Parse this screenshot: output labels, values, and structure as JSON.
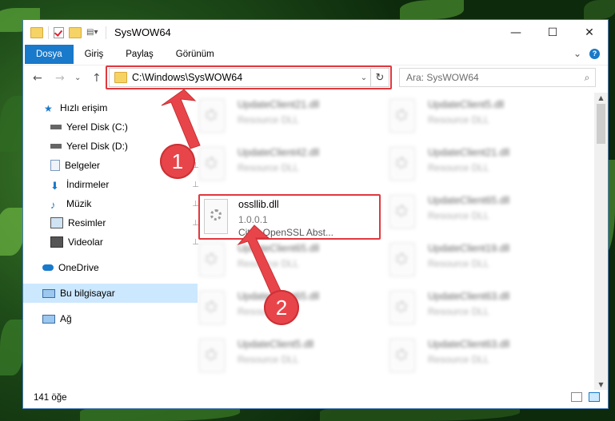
{
  "window": {
    "title": "SysWOW64",
    "buttons": {
      "minimize": "—",
      "maximize": "☐",
      "close": "✕"
    }
  },
  "ribbon": {
    "tabs": [
      "Dosya",
      "Giriş",
      "Paylaş",
      "Görünüm"
    ],
    "expand": "⌄",
    "help": "?"
  },
  "nav": {
    "back": "←",
    "forward": "→",
    "recent": "⌄",
    "up": "↑",
    "address": "C:\\Windows\\SysWOW64",
    "address_chevron": "⌄",
    "refresh": "↻",
    "search_placeholder": "Ara: SysWOW64",
    "search_icon": "⌕"
  },
  "sidebar": {
    "items": [
      {
        "label": "Hızlı erişim",
        "icon": "star-icon",
        "pinned": false
      },
      {
        "label": "Yerel Disk (C:)",
        "icon": "drive-icon",
        "pinned": true
      },
      {
        "label": "Yerel Disk (D:)",
        "icon": "drive-icon",
        "pinned": true
      },
      {
        "label": "Belgeler",
        "icon": "documents-icon",
        "pinned": true
      },
      {
        "label": "İndirmeler",
        "icon": "downloads-icon",
        "pinned": true
      },
      {
        "label": "Müzik",
        "icon": "music-icon",
        "pinned": true
      },
      {
        "label": "Resimler",
        "icon": "pictures-icon",
        "pinned": true
      },
      {
        "label": "Videolar",
        "icon": "videos-icon",
        "pinned": true
      },
      {
        "label": "OneDrive",
        "icon": "cloud-icon",
        "pinned": false
      },
      {
        "label": "Bu bilgisayar",
        "icon": "computer-icon",
        "pinned": false,
        "selected": true
      },
      {
        "label": "Ağ",
        "icon": "network-icon",
        "pinned": false
      }
    ],
    "pin_glyph": "📌"
  },
  "files": {
    "left": [
      {
        "name": "UpdateClient21.dll",
        "desc": "Resource DLL"
      },
      {
        "name": "UpdateClient42.dll",
        "desc": "Resource DLL"
      },
      {
        "name": "",
        "desc": ""
      },
      {
        "name": "UpdateClient65.dll",
        "desc": "Resource DLL"
      },
      {
        "name": "UpdateClient65.dll",
        "desc": "Resource DLL"
      },
      {
        "name": "UpdateClient5.dll",
        "desc": "Resource DLL"
      }
    ],
    "right": [
      {
        "name": "UpdateClient5.dll",
        "desc": "Resource DLL"
      },
      {
        "name": "UpdateClient21.dll",
        "desc": "Resource DLL"
      },
      {
        "name": "UpdateClient65.dll",
        "desc": "Resource DLL"
      },
      {
        "name": "UpdateClient19.dll",
        "desc": "Resource DLL"
      },
      {
        "name": "UpdateClient63.dll",
        "desc": "Resource DLL"
      },
      {
        "name": "UpdateClient63.dll",
        "desc": "Resource DLL"
      }
    ],
    "highlighted": {
      "name": "ossllib.dll",
      "version": "1.0.0.1",
      "desc": "Citrix OpenSSL Abst..."
    }
  },
  "status": {
    "count": "141 öğe"
  },
  "badges": {
    "one": "1",
    "two": "2"
  },
  "colors": {
    "accent": "#1979ca",
    "highlight": "#e0383e",
    "selected": "#cce8ff"
  }
}
